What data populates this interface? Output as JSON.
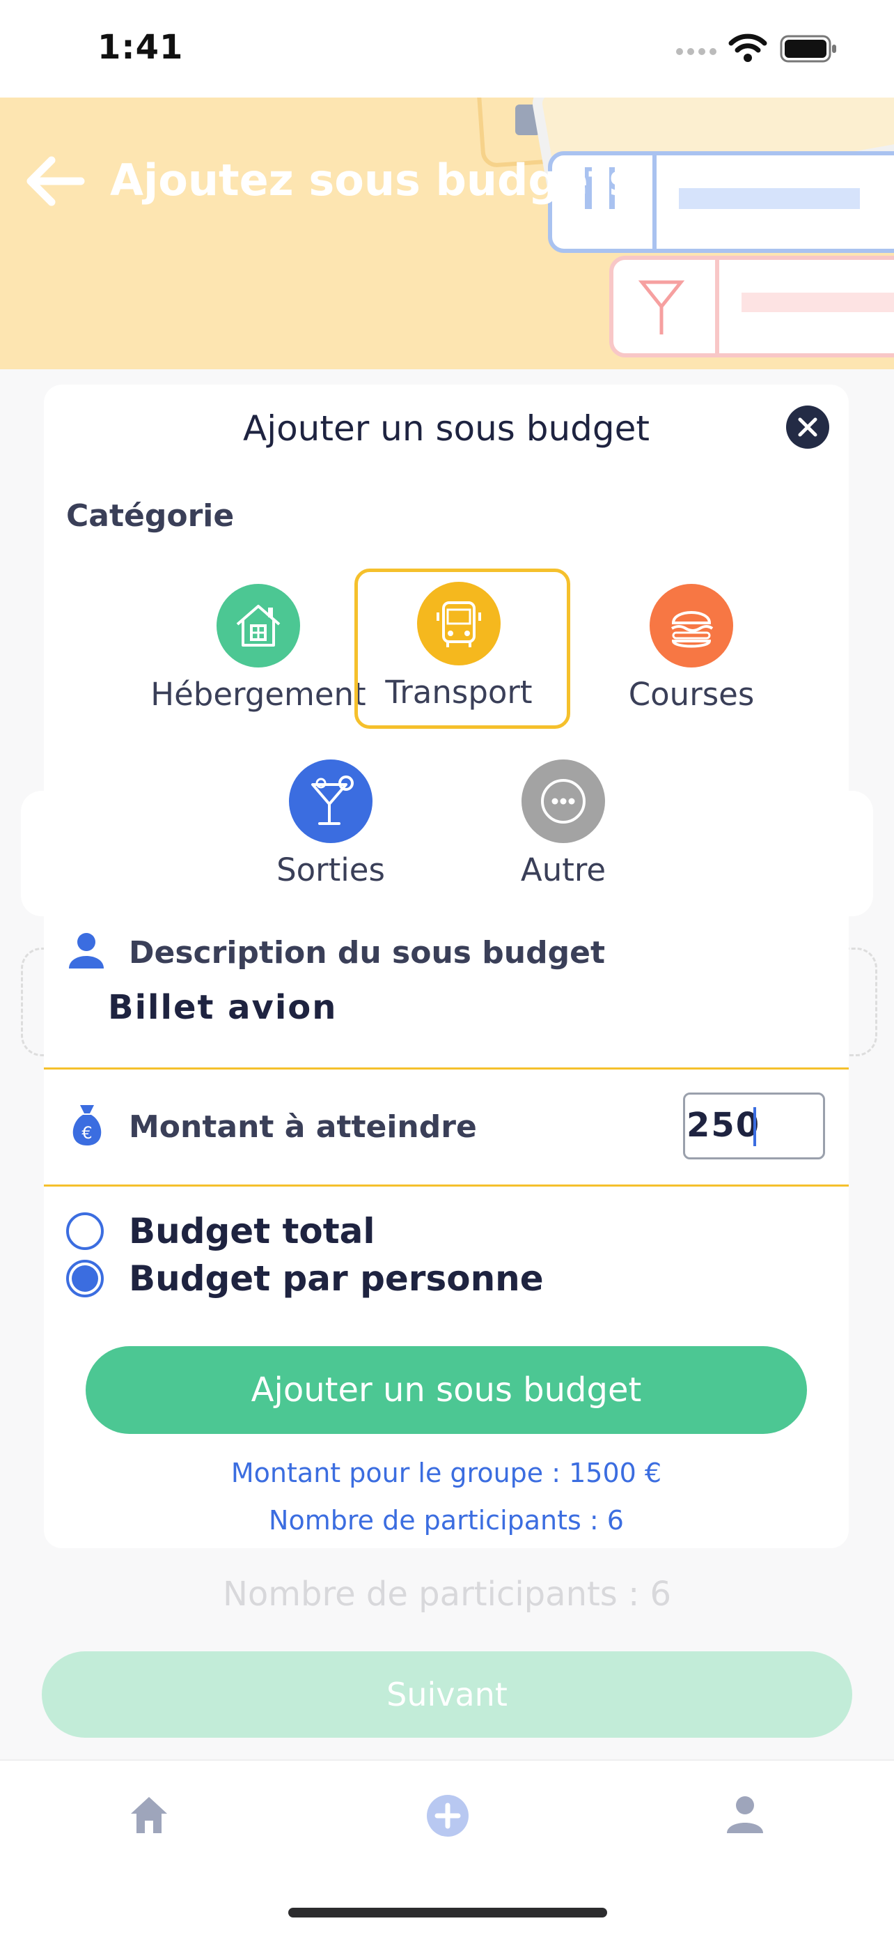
{
  "status_bar": {
    "time": "1:41"
  },
  "header": {
    "title": "Ajoutez sous budgets"
  },
  "background": {
    "participants": "Nombre de participants : 6",
    "next_button": "Suivant"
  },
  "modal": {
    "title": "Ajouter un sous budget",
    "category_label": "Catégorie",
    "categories": [
      {
        "label": "Hébergement",
        "color": "#4cc793",
        "icon": "house-icon",
        "selected": false
      },
      {
        "label": "Transport",
        "color": "#f5b81e",
        "icon": "bus-icon",
        "selected": true
      },
      {
        "label": "Courses",
        "color": "#f77744",
        "icon": "burger-icon",
        "selected": false
      },
      {
        "label": "Sorties",
        "color": "#3b6de0",
        "icon": "cocktail-icon",
        "selected": false
      },
      {
        "label": "Autre",
        "color": "#a3a3a3",
        "icon": "more-icon",
        "selected": false
      }
    ],
    "description_label": "Description du sous budget",
    "description_value": "Billet avion",
    "amount_label": "Montant à atteindre",
    "amount_value": "250",
    "budget_options": [
      {
        "label": "Budget total",
        "selected": false
      },
      {
        "label": "Budget par personne",
        "selected": true
      }
    ],
    "submit_label": "Ajouter un sous budget",
    "group_amount": "Montant pour le groupe : 1500 €",
    "participants": "Nombre de participants : 6"
  },
  "tabbar": {
    "items": [
      "home-icon",
      "add-icon",
      "profile-icon"
    ]
  },
  "colors": {
    "accent_green": "#4cc793",
    "accent_yellow": "#f5c02c",
    "accent_blue": "#3b6de0"
  }
}
